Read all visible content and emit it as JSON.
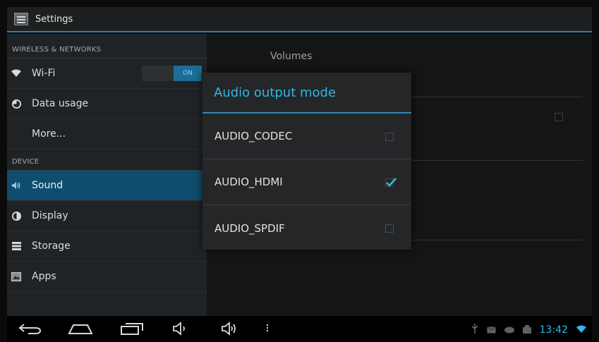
{
  "app": {
    "title": "Settings"
  },
  "sidebar": {
    "wireless_header": "WIRELESS & NETWORKS",
    "wifi_label": "Wi-Fi",
    "wifi_toggle": "ON",
    "data_usage_label": "Data usage",
    "more_label": "More...",
    "device_header": "DEVICE",
    "sound_label": "Sound",
    "display_label": "Display",
    "storage_label": "Storage",
    "apps_label": "Apps"
  },
  "detail": {
    "title": "Volumes"
  },
  "dialog": {
    "title": "Audio output mode",
    "options": [
      {
        "label": "AUDIO_CODEC",
        "checked": false
      },
      {
        "label": "AUDIO_HDMI",
        "checked": true
      },
      {
        "label": "AUDIO_SPDIF",
        "checked": false
      }
    ]
  },
  "navbar": {
    "buttons": [
      "back-icon",
      "home-icon",
      "recent-apps-icon",
      "volume-down-icon",
      "volume-up-icon",
      "menu-icon"
    ],
    "status_icons": [
      "usb-icon",
      "email-icon",
      "gamepad-icon",
      "screenshot-icon",
      "wifi-icon"
    ],
    "clock": "13:42"
  },
  "colors": {
    "accent": "#33b5e5",
    "selected": "#0f4d6e"
  }
}
